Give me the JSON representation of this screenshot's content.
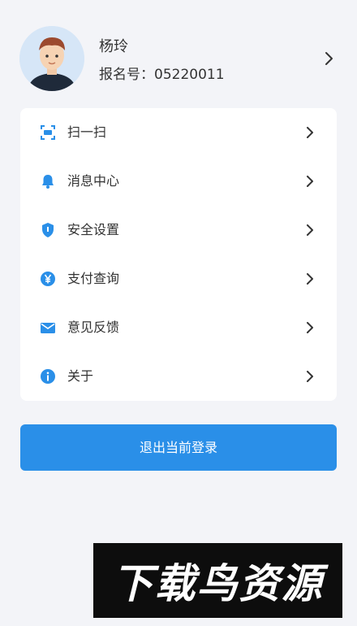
{
  "profile": {
    "name": "杨玲",
    "registration_label": "报名号：05220011"
  },
  "menu": {
    "items": [
      {
        "label": "扫一扫",
        "icon": "scan-icon"
      },
      {
        "label": "消息中心",
        "icon": "bell-icon"
      },
      {
        "label": "安全设置",
        "icon": "shield-icon"
      },
      {
        "label": "支付查询",
        "icon": "yen-icon"
      },
      {
        "label": "意见反馈",
        "icon": "mail-icon"
      },
      {
        "label": "关于",
        "icon": "info-icon"
      }
    ]
  },
  "logout_button": {
    "label": "退出当前登录"
  },
  "watermark": {
    "text": "下载鸟资源"
  },
  "colors": {
    "accent": "#2a8fe8",
    "background": "#f3f4f8"
  }
}
